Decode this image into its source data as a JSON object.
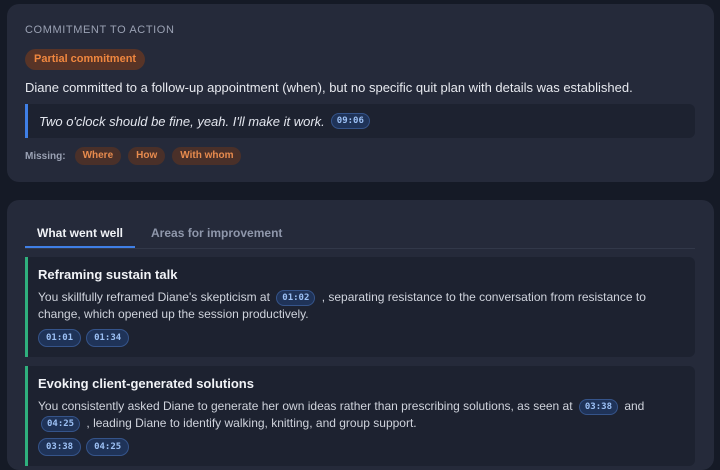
{
  "commitment": {
    "section_label": "COMMITMENT TO ACTION",
    "status": "Partial commitment",
    "summary": "Diane committed to a follow-up appointment (when), but no specific quit plan with details was established.",
    "quote": "Two o'clock should be fine, yeah. I'll make it work.",
    "quote_timestamp": "09:06",
    "missing_label": "Missing:",
    "missing_items": [
      "Where",
      "How",
      "With whom"
    ]
  },
  "feedback": {
    "tabs": [
      {
        "label": "What went well",
        "active": true
      },
      {
        "label": "Areas for improvement",
        "active": false
      }
    ],
    "items": [
      {
        "title": "Reframing sustain talk",
        "body_before": "You skillfully reframed Diane's skepticism at",
        "inline_ts_1": "01:02",
        "body_after": ", separating resistance to the conversation from resistance to change, which opened up the session productively.",
        "timestamps": [
          "01:01",
          "01:34"
        ]
      },
      {
        "title": "Evoking client-generated solutions",
        "body_before": "You consistently asked Diane to generate her own ideas rather than prescribing solutions, as seen at",
        "inline_ts_1": "03:38",
        "body_mid": "and",
        "inline_ts_2": "04:25",
        "body_after": ", leading Diane to identify walking, knitting, and group support.",
        "timestamps": [
          "03:38",
          "04:25"
        ]
      }
    ]
  },
  "colors": {
    "accent": "#3f7fe6",
    "warning": "#f0873f",
    "success": "#2fb07d"
  }
}
